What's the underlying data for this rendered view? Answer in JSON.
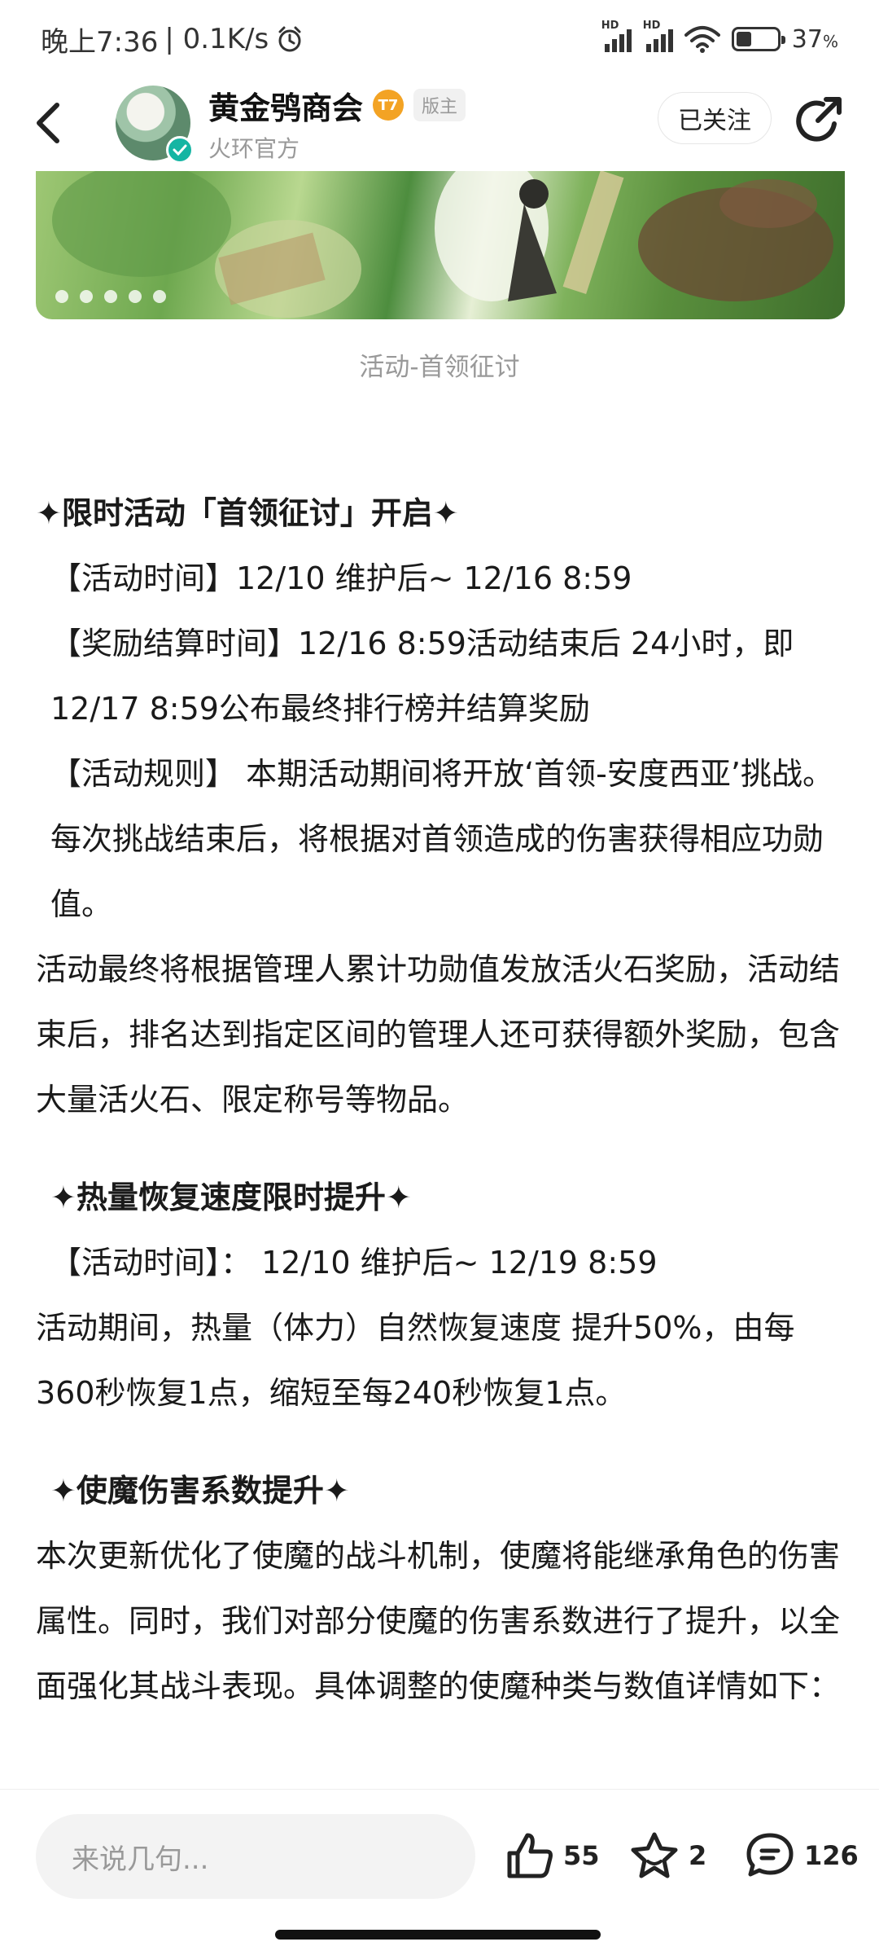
{
  "status": {
    "time": "晚上7:36",
    "speed": "| 0.1K/s",
    "battery": "37",
    "battery_unit": "%",
    "battery_level": 0.37,
    "signal_label": "HD"
  },
  "header": {
    "account_name": "黄金鸮商会",
    "level_badge": "T7",
    "mod_badge": "版主",
    "subtitle": "火环官方",
    "follow_label": "已关注"
  },
  "banner": {
    "caption": "活动-首领征讨"
  },
  "article": {
    "s1_title": "✦限时活动「首领征讨」开启✦",
    "s1_p1": "【活动时间】12/10 维护后~ 12/16 8:59",
    "s1_p2": "【奖励结算时间】12/16 8:59活动结束后 24小时，即12/17 8:59公布最终排行榜并结算奖励",
    "s1_p3": "【活动规则】 本期活动期间将开放‘首领-安度西亚’挑战。每次挑战结束后，将根据对首领造成的伤害获得相应功勋值。",
    "s1_p4": "活动最终将根据管理人累计功勋值发放活火石奖励，活动结束后，排名达到指定区间的管理人还可获得额外奖励，包含大量活火石、限定称号等物品。",
    "s2_title": "✦热量恢复速度限时提升✦",
    "s2_p1": "【活动时间】： 12/10 维护后~ 12/19 8:59",
    "s2_p2": "活动期间，热量（体力）自然恢复速度 提升50%，由每360秒恢复1点，缩短至每240秒恢复1点。",
    "s3_title": "✦使魔伤害系数提升✦",
    "s3_p1": "本次更新优化了使魔的战斗机制，使魔将能继承角色的伤害属性。同时，我们对部分使魔的伤害系数进行了提升，以全面强化其战斗表现。具体调整的使魔种类与数值详情如下："
  },
  "bottom": {
    "comment_placeholder": "来说几句...",
    "likes": "55",
    "favorites": "2",
    "comments": "126"
  },
  "colors": {
    "accent_teal": "#15b5a3",
    "level_orange": "#f3a324",
    "text_gray": "#999999"
  },
  "icons": [
    "back-arrow-icon",
    "verified-icon",
    "share-icon",
    "thumbs-up-icon",
    "star-icon",
    "comment-icon",
    "wifi-icon",
    "alarm-icon",
    "battery-icon",
    "signal-icon"
  ]
}
